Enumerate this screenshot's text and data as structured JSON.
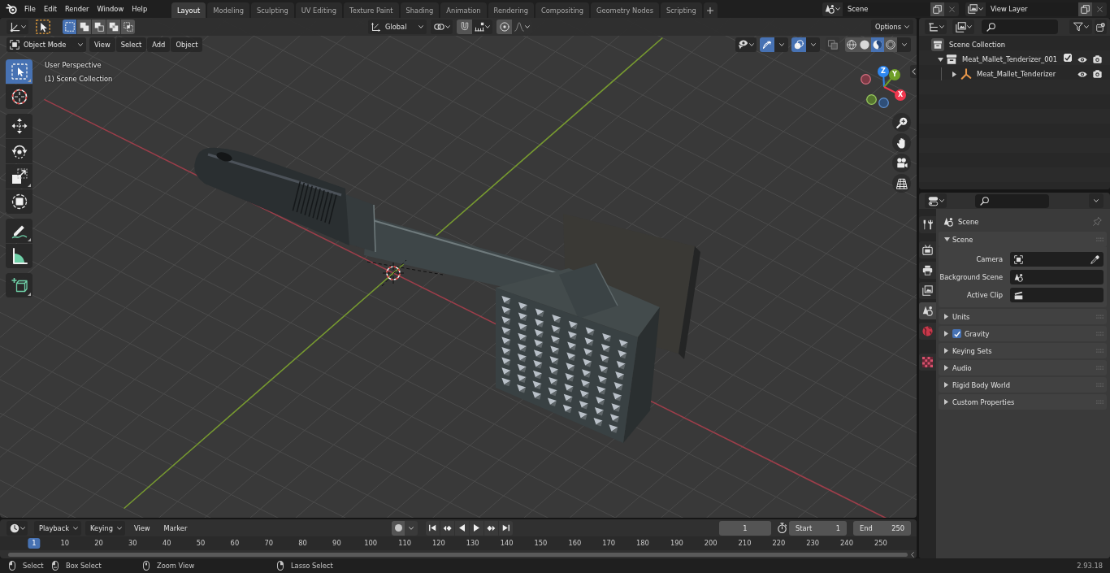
{
  "topbar": {
    "menus": [
      "File",
      "Edit",
      "Render",
      "Window",
      "Help"
    ],
    "workspaces": [
      {
        "label": "Layout",
        "selected": true
      },
      {
        "label": "Modeling",
        "selected": false
      },
      {
        "label": "Sculpting",
        "selected": false
      },
      {
        "label": "UV Editing",
        "selected": false
      },
      {
        "label": "Texture Paint",
        "selected": false
      },
      {
        "label": "Shading",
        "selected": false
      },
      {
        "label": "Animation",
        "selected": false
      },
      {
        "label": "Rendering",
        "selected": false
      },
      {
        "label": "Compositing",
        "selected": false
      },
      {
        "label": "Geometry Nodes",
        "selected": false
      },
      {
        "label": "Scripting",
        "selected": false
      }
    ],
    "scene": "Scene",
    "view_layer": "View Layer"
  },
  "viewport": {
    "tool_header": {
      "select_modes": [
        {
          "kind": "set",
          "selected": true
        },
        {
          "kind": "extend",
          "selected": false
        },
        {
          "kind": "subtract",
          "selected": false
        },
        {
          "kind": "invert",
          "selected": false
        },
        {
          "kind": "intersect",
          "selected": false
        }
      ],
      "orientation": "Global",
      "snap": false,
      "proportional_editing": false,
      "options": "Options"
    },
    "header": {
      "mode": "Object Mode",
      "menus": [
        "View",
        "Select",
        "Add",
        "Object"
      ],
      "gizmos": true,
      "overlays": true,
      "xray": false,
      "shading": [
        {
          "kind": "wireframe",
          "selected": false
        },
        {
          "kind": "solid",
          "selected": false
        },
        {
          "kind": "material_preview",
          "selected": true
        },
        {
          "kind": "rendered",
          "selected": false
        }
      ]
    },
    "overlay_text": [
      "User Perspective",
      "(1) Scene Collection"
    ],
    "toolbar": {
      "groups": [
        {
          "tools": [
            {
              "kind": "select_box",
              "selected": true,
              "flyout": true
            },
            {
              "kind": "cursor",
              "selected": false,
              "flyout": false
            }
          ]
        },
        {
          "tools": [
            {
              "kind": "move",
              "selected": false,
              "flyout": false
            },
            {
              "kind": "rotate",
              "selected": false,
              "flyout": false
            },
            {
              "kind": "scale",
              "selected": false,
              "flyout": true
            },
            {
              "kind": "transform",
              "selected": false,
              "flyout": false
            }
          ]
        },
        {
          "tools": [
            {
              "kind": "annotate",
              "selected": false,
              "flyout": true
            },
            {
              "kind": "measure",
              "selected": false,
              "flyout": false
            }
          ]
        },
        {
          "tools": [
            {
              "kind": "add_cube",
              "selected": false,
              "flyout": true
            }
          ]
        }
      ]
    },
    "gizmo": {
      "axes": [
        {
          "kind": "positive",
          "label": "Z",
          "color": "#2e86ef"
        },
        {
          "kind": "positive",
          "label": "Y",
          "color": "#6f9f28"
        },
        {
          "kind": "negative",
          "color": "#7c3a45"
        },
        {
          "kind": "positive",
          "label": "X",
          "color": "#f0384f"
        },
        {
          "kind": "negative",
          "color": "#55752f"
        },
        {
          "kind": "negative",
          "color": "#2f4f78"
        }
      ]
    }
  },
  "outliner": {
    "tree": [
      {
        "kind": "scene_collection",
        "label": "Scene Collection",
        "children": [
          {
            "kind": "collection",
            "label": "Meat_Mallet_Tenderizer_001",
            "expanded": true,
            "checked": true,
            "children": [
              {
                "kind": "empty",
                "label": "Meat_Mallet_Tenderizer",
                "expanded": false
              }
            ]
          }
        ]
      }
    ]
  },
  "properties": {
    "tab_groups": [
      {
        "tabs": [
          {
            "kind": "tool",
            "selected": false
          }
        ]
      },
      {
        "tabs": [
          {
            "kind": "render",
            "selected": false
          },
          {
            "kind": "output",
            "selected": false
          },
          {
            "kind": "view_layer",
            "selected": false
          },
          {
            "kind": "scene",
            "selected": true
          },
          {
            "kind": "world",
            "selected": false
          }
        ]
      },
      {
        "tabs": [
          {
            "kind": "texture",
            "selected": false
          }
        ]
      }
    ],
    "context": "Scene",
    "panels": [
      {
        "kind": "plain",
        "title": "Scene",
        "expanded": true,
        "fields": [
          {
            "kind": "camera",
            "label": "Camera"
          },
          {
            "kind": "scene",
            "label": "Background Scene"
          },
          {
            "kind": "clip",
            "label": "Active Clip"
          }
        ]
      },
      {
        "kind": "plain",
        "title": "Units",
        "expanded": false
      },
      {
        "kind": "toggle",
        "title": "Gravity",
        "expanded": false,
        "checked": true
      },
      {
        "kind": "plain",
        "title": "Keying Sets",
        "expanded": false
      },
      {
        "kind": "plain",
        "title": "Audio",
        "expanded": false
      },
      {
        "kind": "plain",
        "title": "Rigid Body World",
        "expanded": false
      },
      {
        "kind": "plain",
        "title": "Custom Properties",
        "expanded": false
      }
    ]
  },
  "timeline": {
    "menus": [
      {
        "kind": "dropdown",
        "label": "Playback"
      },
      {
        "kind": "dropdown",
        "label": "Keying"
      },
      {
        "kind": "menu",
        "label": "View"
      },
      {
        "kind": "menu",
        "label": "Marker"
      }
    ],
    "auto_keying": false,
    "current_frame": "1",
    "start": {
      "label": "Start",
      "value": "1"
    },
    "end": {
      "label": "End",
      "value": "250"
    },
    "frames": [
      {
        "label": "1",
        "selected": true
      },
      {
        "label": "10",
        "selected": false
      },
      {
        "label": "20",
        "selected": false
      },
      {
        "label": "30",
        "selected": false
      },
      {
        "label": "40",
        "selected": false
      },
      {
        "label": "50",
        "selected": false
      },
      {
        "label": "60",
        "selected": false
      },
      {
        "label": "70",
        "selected": false
      },
      {
        "label": "80",
        "selected": false
      },
      {
        "label": "90",
        "selected": false
      },
      {
        "label": "100",
        "selected": false
      },
      {
        "label": "110",
        "selected": false
      },
      {
        "label": "120",
        "selected": false
      },
      {
        "label": "130",
        "selected": false
      },
      {
        "label": "140",
        "selected": false
      },
      {
        "label": "150",
        "selected": false
      },
      {
        "label": "160",
        "selected": false
      },
      {
        "label": "170",
        "selected": false
      },
      {
        "label": "180",
        "selected": false
      },
      {
        "label": "190",
        "selected": false
      },
      {
        "label": "200",
        "selected": false
      },
      {
        "label": "210",
        "selected": false
      },
      {
        "label": "220",
        "selected": false
      },
      {
        "label": "230",
        "selected": false
      },
      {
        "label": "240",
        "selected": false
      },
      {
        "label": "250",
        "selected": false
      }
    ]
  },
  "status_bar": {
    "hints": [
      {
        "kind": "left_click",
        "label": "Select"
      },
      {
        "kind": "left_drag",
        "label": "Box Select"
      },
      {
        "kind": "middle_click",
        "label": "Zoom View"
      },
      {
        "kind": "right_drag",
        "label": "Lasso Select"
      }
    ],
    "version": "2.93.18"
  }
}
